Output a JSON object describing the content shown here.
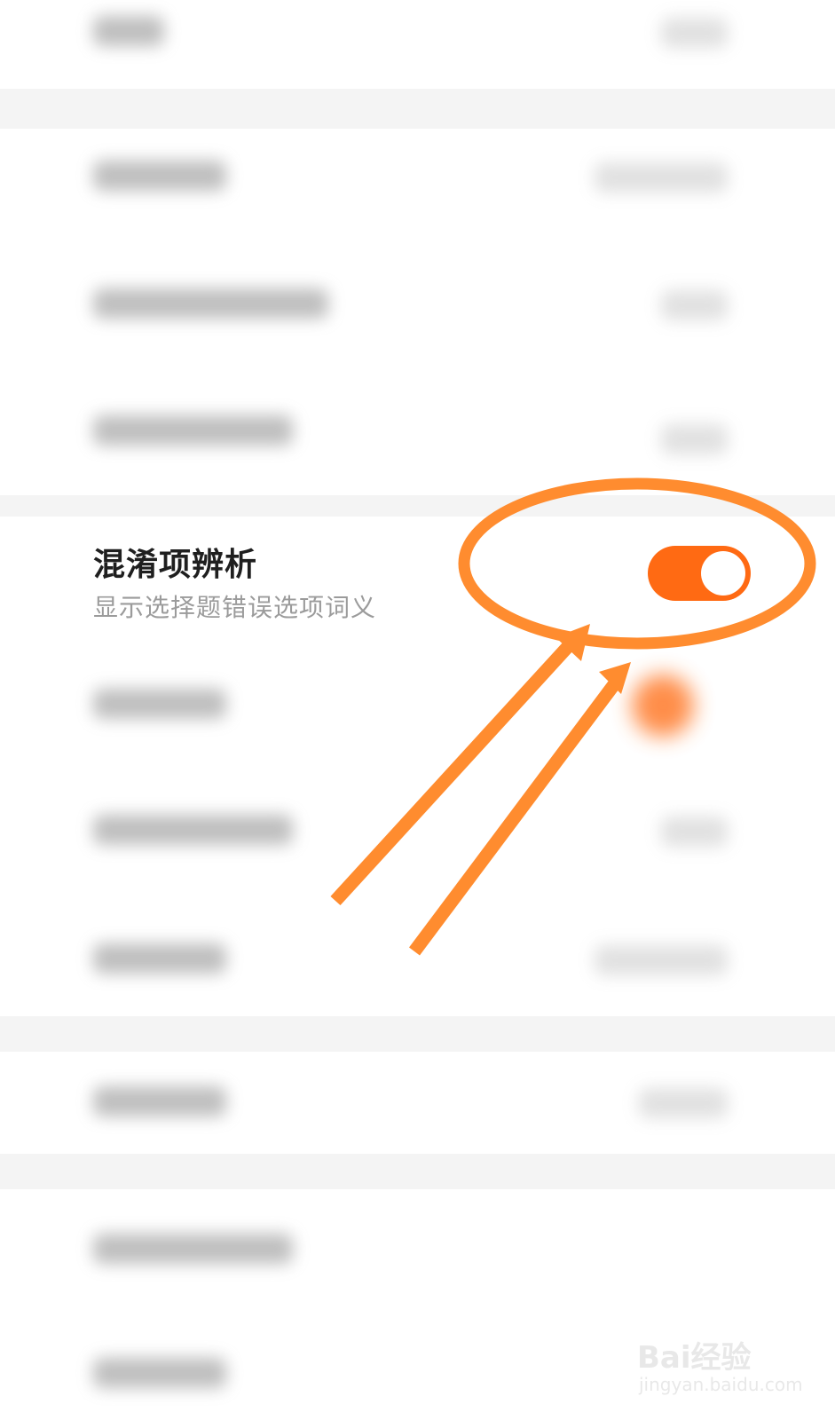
{
  "setting": {
    "title": "混淆项辨析",
    "subtitle": "显示选择题错误选项词义",
    "toggle_on": true
  },
  "colors": {
    "accent": "#ff6a13",
    "annotation": "#ff8c2f",
    "title_text": "#1f1f1f",
    "subtitle_text": "#9b9b9b"
  },
  "watermark": {
    "brand": "Bai经验",
    "url": "jingyan.baidu.com"
  }
}
